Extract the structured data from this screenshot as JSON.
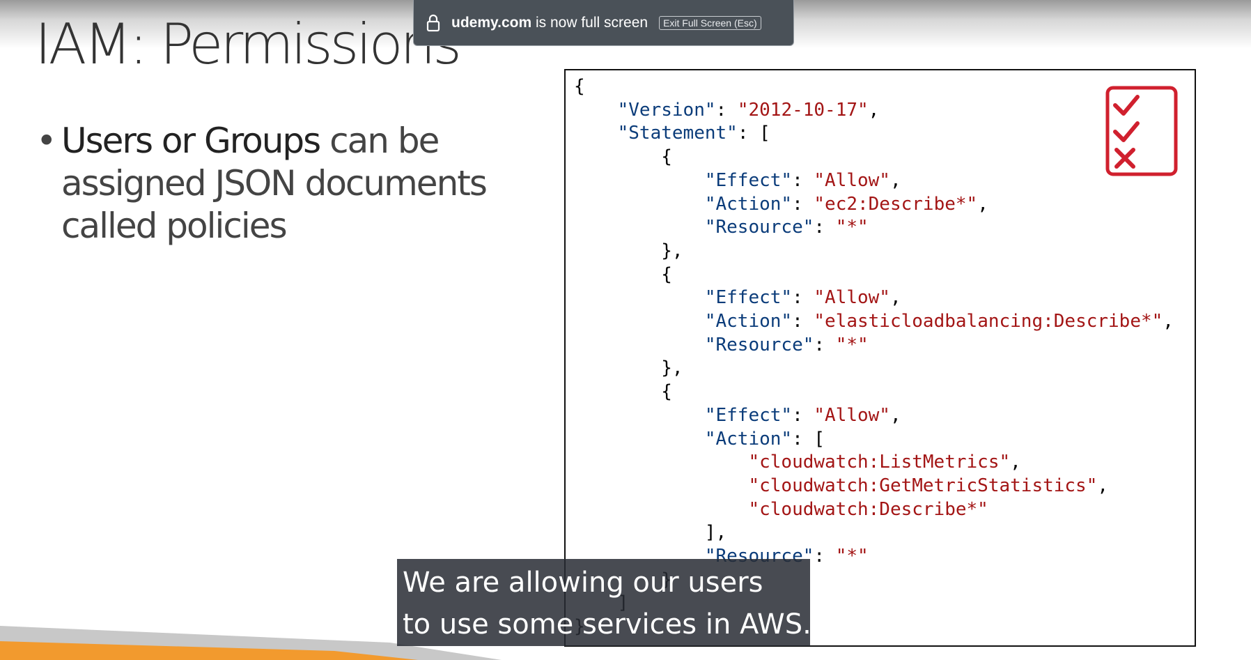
{
  "slide": {
    "title": "IAM: Permissions",
    "bullet_bold": "Users or Groups",
    "bullet_rest": " can be assigned JSON documents called policies"
  },
  "policy": {
    "lines": [
      [
        [
          "p",
          "{"
        ]
      ],
      [
        [
          "p",
          "    "
        ],
        [
          "k",
          "\"Version\""
        ],
        [
          "p",
          ": "
        ],
        [
          "s",
          "\"2012-10-17\""
        ],
        [
          "p",
          ","
        ]
      ],
      [
        [
          "p",
          "    "
        ],
        [
          "k",
          "\"Statement\""
        ],
        [
          "p",
          ": ["
        ]
      ],
      [
        [
          "p",
          "        {"
        ]
      ],
      [
        [
          "p",
          "            "
        ],
        [
          "k",
          "\"Effect\""
        ],
        [
          "p",
          ": "
        ],
        [
          "s",
          "\"Allow\""
        ],
        [
          "p",
          ","
        ]
      ],
      [
        [
          "p",
          "            "
        ],
        [
          "k",
          "\"Action\""
        ],
        [
          "p",
          ": "
        ],
        [
          "s",
          "\"ec2:Describe*\""
        ],
        [
          "p",
          ","
        ]
      ],
      [
        [
          "p",
          "            "
        ],
        [
          "k",
          "\"Resource\""
        ],
        [
          "p",
          ": "
        ],
        [
          "s",
          "\"*\""
        ]
      ],
      [
        [
          "p",
          "        },"
        ]
      ],
      [
        [
          "p",
          "        {"
        ]
      ],
      [
        [
          "p",
          "            "
        ],
        [
          "k",
          "\"Effect\""
        ],
        [
          "p",
          ": "
        ],
        [
          "s",
          "\"Allow\""
        ],
        [
          "p",
          ","
        ]
      ],
      [
        [
          "p",
          "            "
        ],
        [
          "k",
          "\"Action\""
        ],
        [
          "p",
          ": "
        ],
        [
          "s",
          "\"elasticloadbalancing:Describe*\""
        ],
        [
          "p",
          ","
        ]
      ],
      [
        [
          "p",
          "            "
        ],
        [
          "k",
          "\"Resource\""
        ],
        [
          "p",
          ": "
        ],
        [
          "s",
          "\"*\""
        ]
      ],
      [
        [
          "p",
          "        },"
        ]
      ],
      [
        [
          "p",
          "        {"
        ]
      ],
      [
        [
          "p",
          "            "
        ],
        [
          "k",
          "\"Effect\""
        ],
        [
          "p",
          ": "
        ],
        [
          "s",
          "\"Allow\""
        ],
        [
          "p",
          ","
        ]
      ],
      [
        [
          "p",
          "            "
        ],
        [
          "k",
          "\"Action\""
        ],
        [
          "p",
          ": ["
        ]
      ],
      [
        [
          "p",
          "                "
        ],
        [
          "s",
          "\"cloudwatch:ListMetrics\""
        ],
        [
          "p",
          ","
        ]
      ],
      [
        [
          "p",
          "                "
        ],
        [
          "s",
          "\"cloudwatch:GetMetricStatistics\""
        ],
        [
          "p",
          ","
        ]
      ],
      [
        [
          "p",
          "                "
        ],
        [
          "s",
          "\"cloudwatch:Describe*\""
        ]
      ],
      [
        [
          "p",
          "            ],"
        ]
      ],
      [
        [
          "p",
          "            "
        ],
        [
          "k",
          "\"Resource\""
        ],
        [
          "p",
          ": "
        ],
        [
          "s",
          "\"*\""
        ]
      ],
      [
        [
          "p",
          "        }"
        ]
      ],
      [
        [
          "p",
          "    ]"
        ]
      ],
      [
        [
          "p",
          "}"
        ]
      ]
    ]
  },
  "toast": {
    "domain": "udemy.com",
    "message": " is now full screen",
    "exit_label": "Exit Full Screen (Esc)"
  },
  "caption": {
    "line1": "We are allowing our users",
    "line2": "to use some services in AWS."
  },
  "colors": {
    "json_key": "#0b3c7a",
    "json_string": "#a31515",
    "icon_red": "#d0202e",
    "accent_orange": "#f29a2e",
    "accent_grey": "#c8c8c8"
  },
  "icons": {
    "checklist": "checklist-icon",
    "lock": "lock-icon"
  }
}
